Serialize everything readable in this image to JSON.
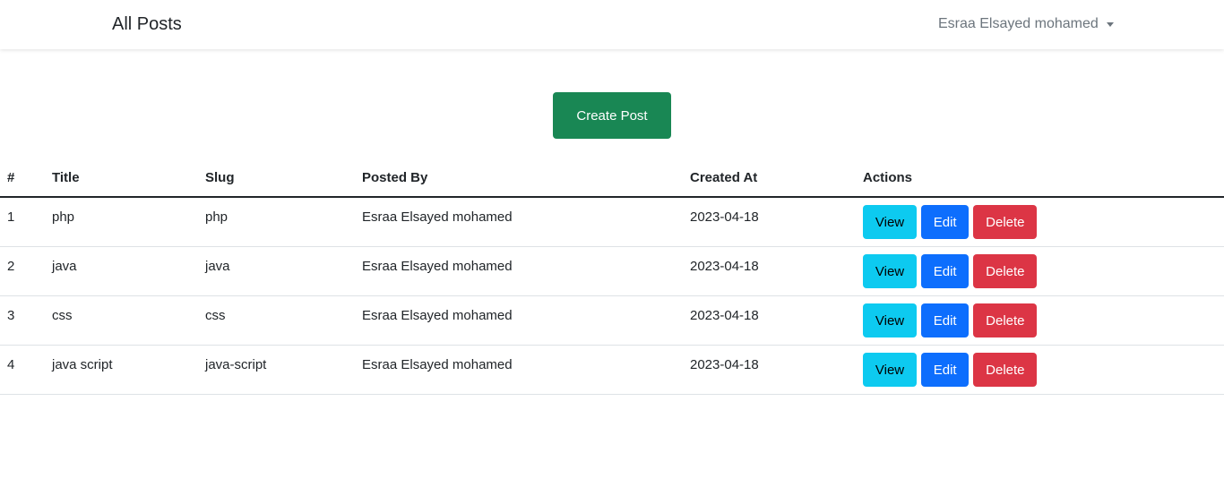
{
  "navbar": {
    "brand": "All Posts",
    "user_name": "Esraa Elsayed mohamed"
  },
  "create_button_label": "Create Post",
  "table": {
    "headers": [
      "#",
      "Title",
      "Slug",
      "Posted By",
      "Created At",
      "Actions"
    ],
    "rows": [
      {
        "num": "1",
        "title": "php",
        "slug": "php",
        "posted_by": "Esraa Elsayed mohamed",
        "created_at": "2023-04-18"
      },
      {
        "num": "2",
        "title": "java",
        "slug": "java",
        "posted_by": "Esraa Elsayed mohamed",
        "created_at": "2023-04-18"
      },
      {
        "num": "3",
        "title": "css",
        "slug": "css",
        "posted_by": "Esraa Elsayed mohamed",
        "created_at": "2023-04-18"
      },
      {
        "num": "4",
        "title": "java script",
        "slug": "java-script",
        "posted_by": "Esraa Elsayed mohamed",
        "created_at": "2023-04-18"
      }
    ],
    "actions": {
      "view": "View",
      "edit": "Edit",
      "delete": "Delete"
    }
  },
  "colors": {
    "create": "#198754",
    "view": "#0dcaf0",
    "edit": "#0d6efd",
    "delete": "#dc3545"
  }
}
